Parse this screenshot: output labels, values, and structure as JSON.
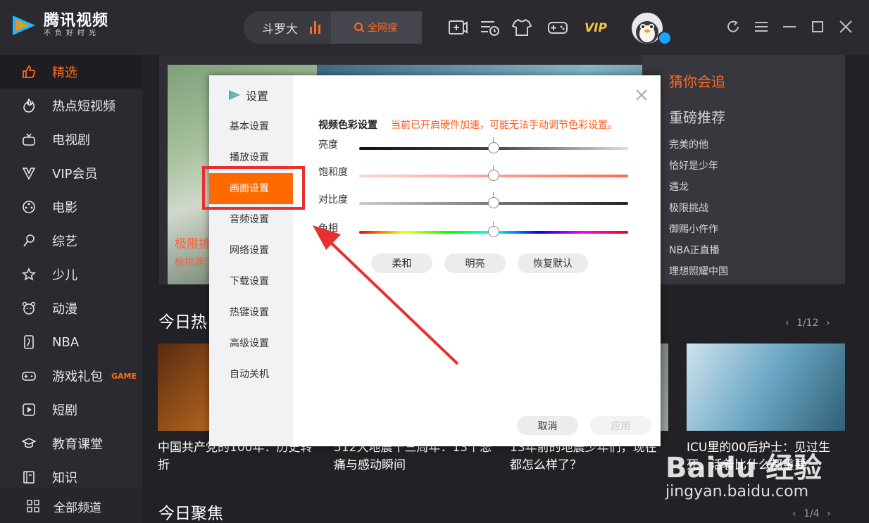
{
  "app": {
    "title": "腾讯视频",
    "slogan": "不负好时光"
  },
  "search": {
    "value": "斗罗大",
    "button_label": "全网搜"
  },
  "toolbar": {
    "vip_label": "VIP",
    "icons": [
      "upload-icon",
      "history-icon",
      "skin-icon",
      "game-icon",
      "vip-icon"
    ]
  },
  "sidebar": {
    "items": [
      {
        "label": "精选",
        "icon": "thumb-up-icon",
        "active": true
      },
      {
        "label": "热点短视频",
        "icon": "fire-icon"
      },
      {
        "label": "电视剧",
        "icon": "tv-icon"
      },
      {
        "label": "VIP会员",
        "icon": "vip-crown-icon"
      },
      {
        "label": "电影",
        "icon": "film-reel-icon"
      },
      {
        "label": "综艺",
        "icon": "microphone-icon"
      },
      {
        "label": "少儿",
        "icon": "star-kid-icon"
      },
      {
        "label": "动漫",
        "icon": "bear-face-icon"
      },
      {
        "label": "NBA",
        "icon": "nba-icon"
      },
      {
        "label": "游戏礼包",
        "icon": "gamepad-icon",
        "tag": "GAME"
      },
      {
        "label": "短剧",
        "icon": "play-box-icon"
      },
      {
        "label": "教育课堂",
        "icon": "graduation-cap-icon"
      },
      {
        "label": "知识",
        "icon": "book-icon"
      }
    ],
    "all_channels": "全部频道"
  },
  "banner": {
    "caption_title": "极限挑",
    "caption_sub": "极挑澳门",
    "panel_title": "猜你会追",
    "panel_title2": "重磅推荐",
    "recommend": [
      "完美的他",
      "恰好是少年",
      "遇龙",
      "极限挑战",
      "御赐小仵作",
      "NBA正直播",
      "理想照耀中国"
    ]
  },
  "hot_today": {
    "title": "今日热",
    "pager": "1/12",
    "cards": [
      {
        "title": "中国共产党的100年：历史转折"
      },
      {
        "title": "512大地震十三周年：13个悲痛与感动瞬间"
      },
      {
        "title": "13年前的地震少年们，现在都怎么样了？"
      },
      {
        "title": "ICU里的00后护士：见过生死，活着比什么都重要"
      }
    ]
  },
  "focus_today": {
    "title": "今日聚焦",
    "pager": "1/4"
  },
  "settings_dialog": {
    "title": "设置",
    "nav": [
      "基本设置",
      "播放设置",
      "画面设置",
      "音频设置",
      "网络设置",
      "下载设置",
      "热键设置",
      "高级设置",
      "自动关机"
    ],
    "active_nav": "画面设置",
    "section_title": "视频色彩设置",
    "warning": "当前已开启硬件加速，可能无法手动调节色彩设置。",
    "sliders": [
      {
        "label": "亮度",
        "value": 0.5
      },
      {
        "label": "饱和度",
        "value": 0.5
      },
      {
        "label": "对比度",
        "value": 0.5
      },
      {
        "label": "色相",
        "value": 0.5
      }
    ],
    "presets": [
      "柔和",
      "明亮",
      "恢复默认"
    ],
    "cancel": "取消",
    "apply": "应用"
  },
  "watermark": {
    "line1": "Baidu 经验",
    "line2": "jingyan.baidu.com"
  },
  "colors": {
    "accent": "#ff6a1f",
    "highlight_box": "#e8312f",
    "sidebar_bg": "#2a2a30"
  }
}
